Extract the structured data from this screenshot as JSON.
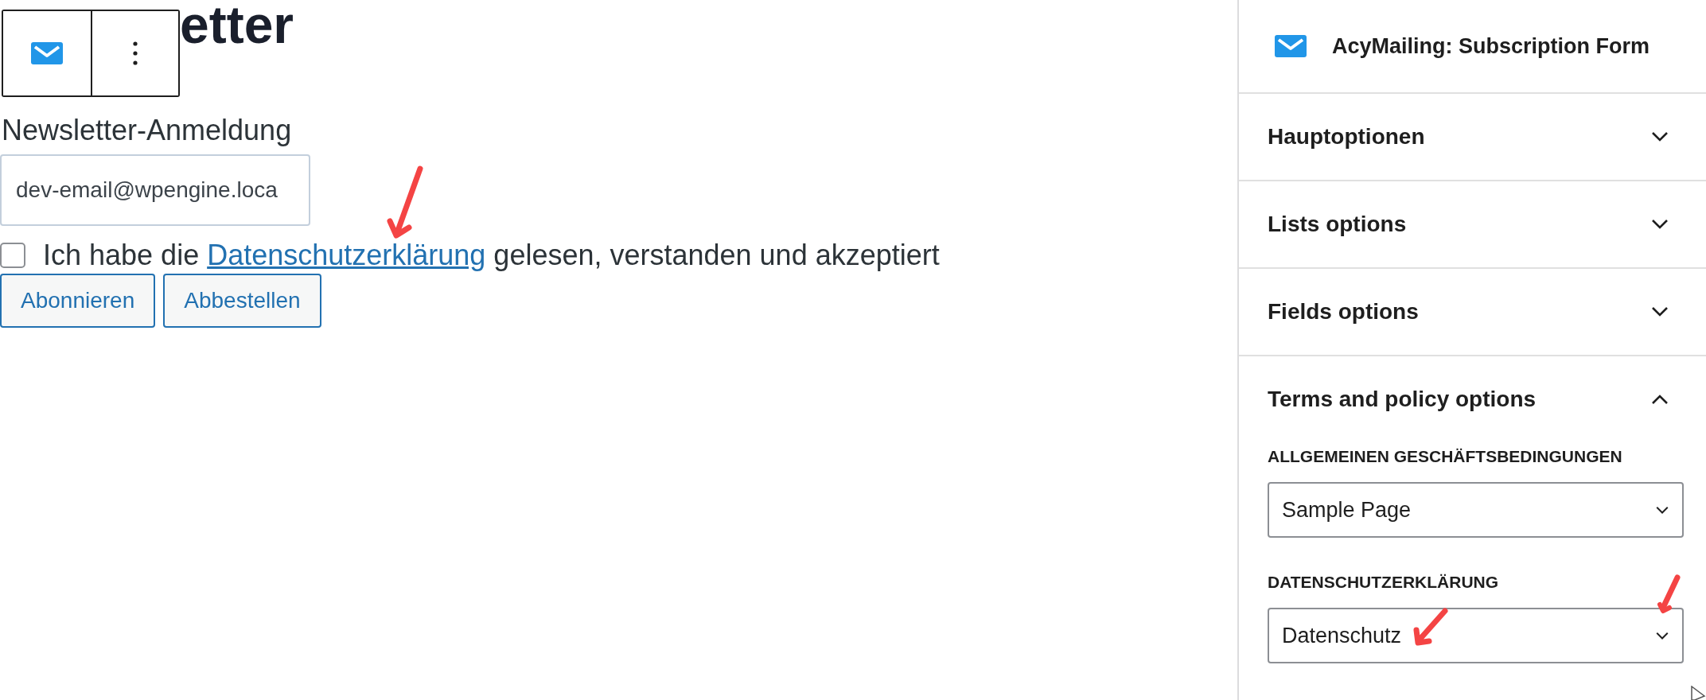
{
  "heading": "etter",
  "form": {
    "label": "Newsletter-Anmeldung",
    "email": {
      "value": "dev-email@wpengine.loca"
    },
    "consent": {
      "checked": false,
      "before": "Ich habe die ",
      "link": "Datenschutzerklärung",
      "after": " gelesen, verstanden und akzeptiert"
    },
    "buttons": [
      "Abonnieren",
      "Abbestellen"
    ]
  },
  "sidebar": {
    "block_title": "AcyMailing: Subscription Form",
    "panels": [
      {
        "title": "Hauptoptionen",
        "expanded": false
      },
      {
        "title": "Lists options",
        "expanded": false
      },
      {
        "title": "Fields options",
        "expanded": false
      },
      {
        "title": "Terms and policy options",
        "expanded": true,
        "fields": [
          {
            "label": "ALLGEMEINEN GESCHÄFTSBEDINGUNGEN",
            "value": "Sample Page"
          },
          {
            "label": "DATENSCHUTZERKLÄRUNG",
            "value": "Datenschutz"
          }
        ]
      }
    ]
  }
}
